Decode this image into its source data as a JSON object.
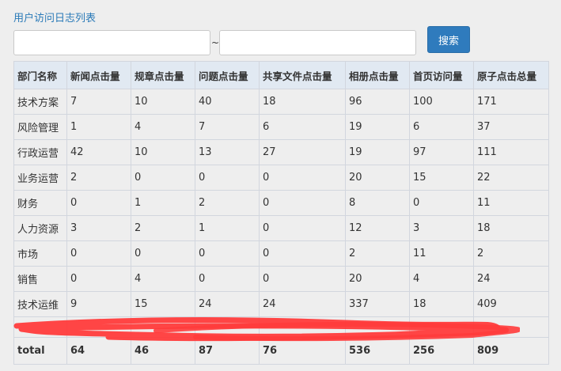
{
  "page": {
    "title": "用户访问日志列表"
  },
  "search": {
    "range_separator": "~",
    "start_value": "",
    "end_value": "",
    "button_label": "搜索"
  },
  "table": {
    "headers": [
      "部门名称",
      "新闻点击量",
      "规章点击量",
      "问题点击量",
      "共享文件点击量",
      "相册点击量",
      "首页访问量",
      "原子点击总量"
    ],
    "rows": [
      [
        "技术方案",
        "7",
        "10",
        "40",
        "18",
        "96",
        "100",
        "171"
      ],
      [
        "风险管理",
        "1",
        "4",
        "7",
        "6",
        "19",
        "6",
        "37"
      ],
      [
        "行政运营",
        "42",
        "10",
        "13",
        "27",
        "19",
        "97",
        "111"
      ],
      [
        "业务运营",
        "2",
        "0",
        "0",
        "0",
        "20",
        "15",
        "22"
      ],
      [
        "财务",
        "0",
        "1",
        "2",
        "0",
        "8",
        "0",
        "11"
      ],
      [
        "人力资源",
        "3",
        "2",
        "1",
        "0",
        "12",
        "3",
        "18"
      ],
      [
        "市场",
        "0",
        "0",
        "0",
        "0",
        "2",
        "11",
        "2"
      ],
      [
        "销售",
        "0",
        "4",
        "0",
        "0",
        "20",
        "4",
        "24"
      ],
      [
        "技术运维",
        "9",
        "15",
        "24",
        "24",
        "337",
        "18",
        "409"
      ]
    ],
    "totals": [
      "total",
      "64",
      "46",
      "87",
      "76",
      "536",
      "256",
      "809"
    ]
  },
  "colors": {
    "accent": "#2f7bbd",
    "title": "#2a7ab8",
    "header_bg": "#e1e9f2",
    "page_bg": "#eeeeee",
    "redaction": "#ff3b3b"
  }
}
